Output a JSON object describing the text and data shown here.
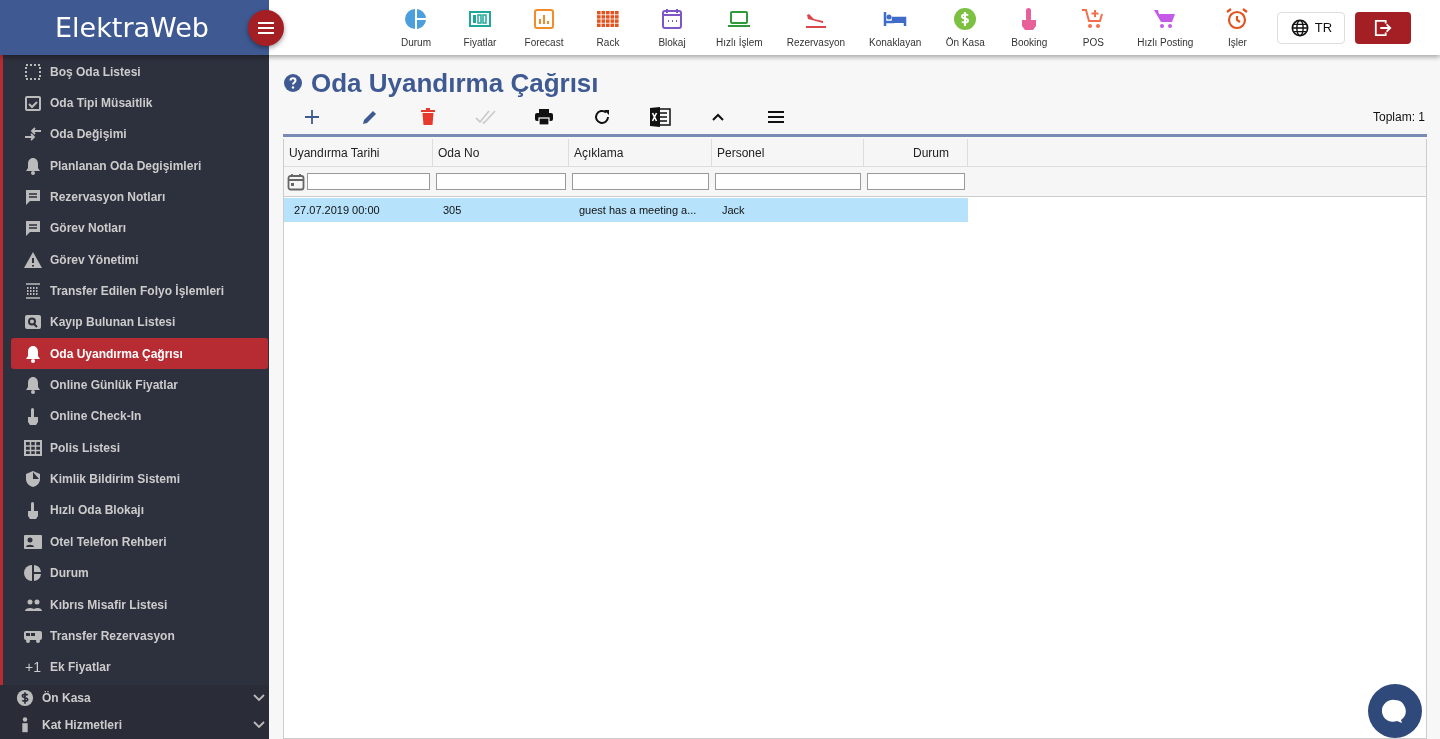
{
  "app": {
    "logo": "ElektraWeb"
  },
  "top_nav": [
    {
      "label": "Durum",
      "color": "#4a9fdc"
    },
    {
      "label": "Fiyatlar",
      "color": "#1fa89a"
    },
    {
      "label": "Forecast",
      "color": "#ef8c2c"
    },
    {
      "label": "Rack",
      "color": "#e2531f"
    },
    {
      "label": "Blokaj",
      "color": "#7c55c7"
    },
    {
      "label": "Hızlı İşlem",
      "color": "#2e9a3a"
    },
    {
      "label": "Rezervasyon",
      "color": "#d9464c"
    },
    {
      "label": "Konaklayan",
      "color": "#3e6cc8"
    },
    {
      "label": "Ön Kasa",
      "color": "#7dc142"
    },
    {
      "label": "Booking",
      "color": "#e7609a"
    },
    {
      "label": "POS",
      "color": "#f0704e"
    },
    {
      "label": "Hızlı Posting",
      "color": "#c65ae8"
    },
    {
      "label": "Işler",
      "color": "#e2531f"
    }
  ],
  "language": {
    "label": "TR"
  },
  "sidebar": {
    "items": [
      {
        "label": "Boş Oda Listesi",
        "selected": false
      },
      {
        "label": "Oda Tipi Müsaitlik",
        "selected": false
      },
      {
        "label": "Oda Değişimi",
        "selected": false
      },
      {
        "label": "Planlanan Oda Degişimleri",
        "selected": false
      },
      {
        "label": "Rezervasyon Notları",
        "selected": false
      },
      {
        "label": "Görev Notları",
        "selected": false
      },
      {
        "label": "Görev Yönetimi",
        "selected": false
      },
      {
        "label": "Transfer Edilen Folyo İşlemleri",
        "selected": false
      },
      {
        "label": "Kayıp Bulunan Listesi",
        "selected": false
      },
      {
        "label": "Oda Uyandırma Çağrısı",
        "selected": true
      },
      {
        "label": "Online Günlük Fiyatlar",
        "selected": false
      },
      {
        "label": "Online Check-In",
        "selected": false
      },
      {
        "label": "Polis Listesi",
        "selected": false
      },
      {
        "label": "Kimlik Bildirim Sistemi",
        "selected": false
      },
      {
        "label": "Hızlı Oda Blokajı",
        "selected": false
      },
      {
        "label": "Otel Telefon Rehberi",
        "selected": false
      },
      {
        "label": "Durum",
        "selected": false
      },
      {
        "label": "Kıbrıs Misafir Listesi",
        "selected": false
      },
      {
        "label": "Transfer Rezervasyon",
        "selected": false
      },
      {
        "label": "Ek Fiyatlar",
        "selected": false,
        "icon_text": "+1"
      }
    ],
    "groups": [
      {
        "label": "Ön Kasa",
        "expanded": false
      },
      {
        "label": "Kat Hizmetleri",
        "expanded": false
      }
    ]
  },
  "page": {
    "title": "Oda Uyandırma Çağrısı",
    "total": "Toplam: 1"
  },
  "table": {
    "columns": [
      "Uyandırma Tarihi",
      "Oda No",
      "Açıklama",
      "Personel",
      "Durum"
    ],
    "rows": [
      {
        "selected": true,
        "cells": [
          "27.07.2019 00:00",
          "305",
          "guest has a meeting a...",
          "Jack"
        ]
      }
    ]
  }
}
